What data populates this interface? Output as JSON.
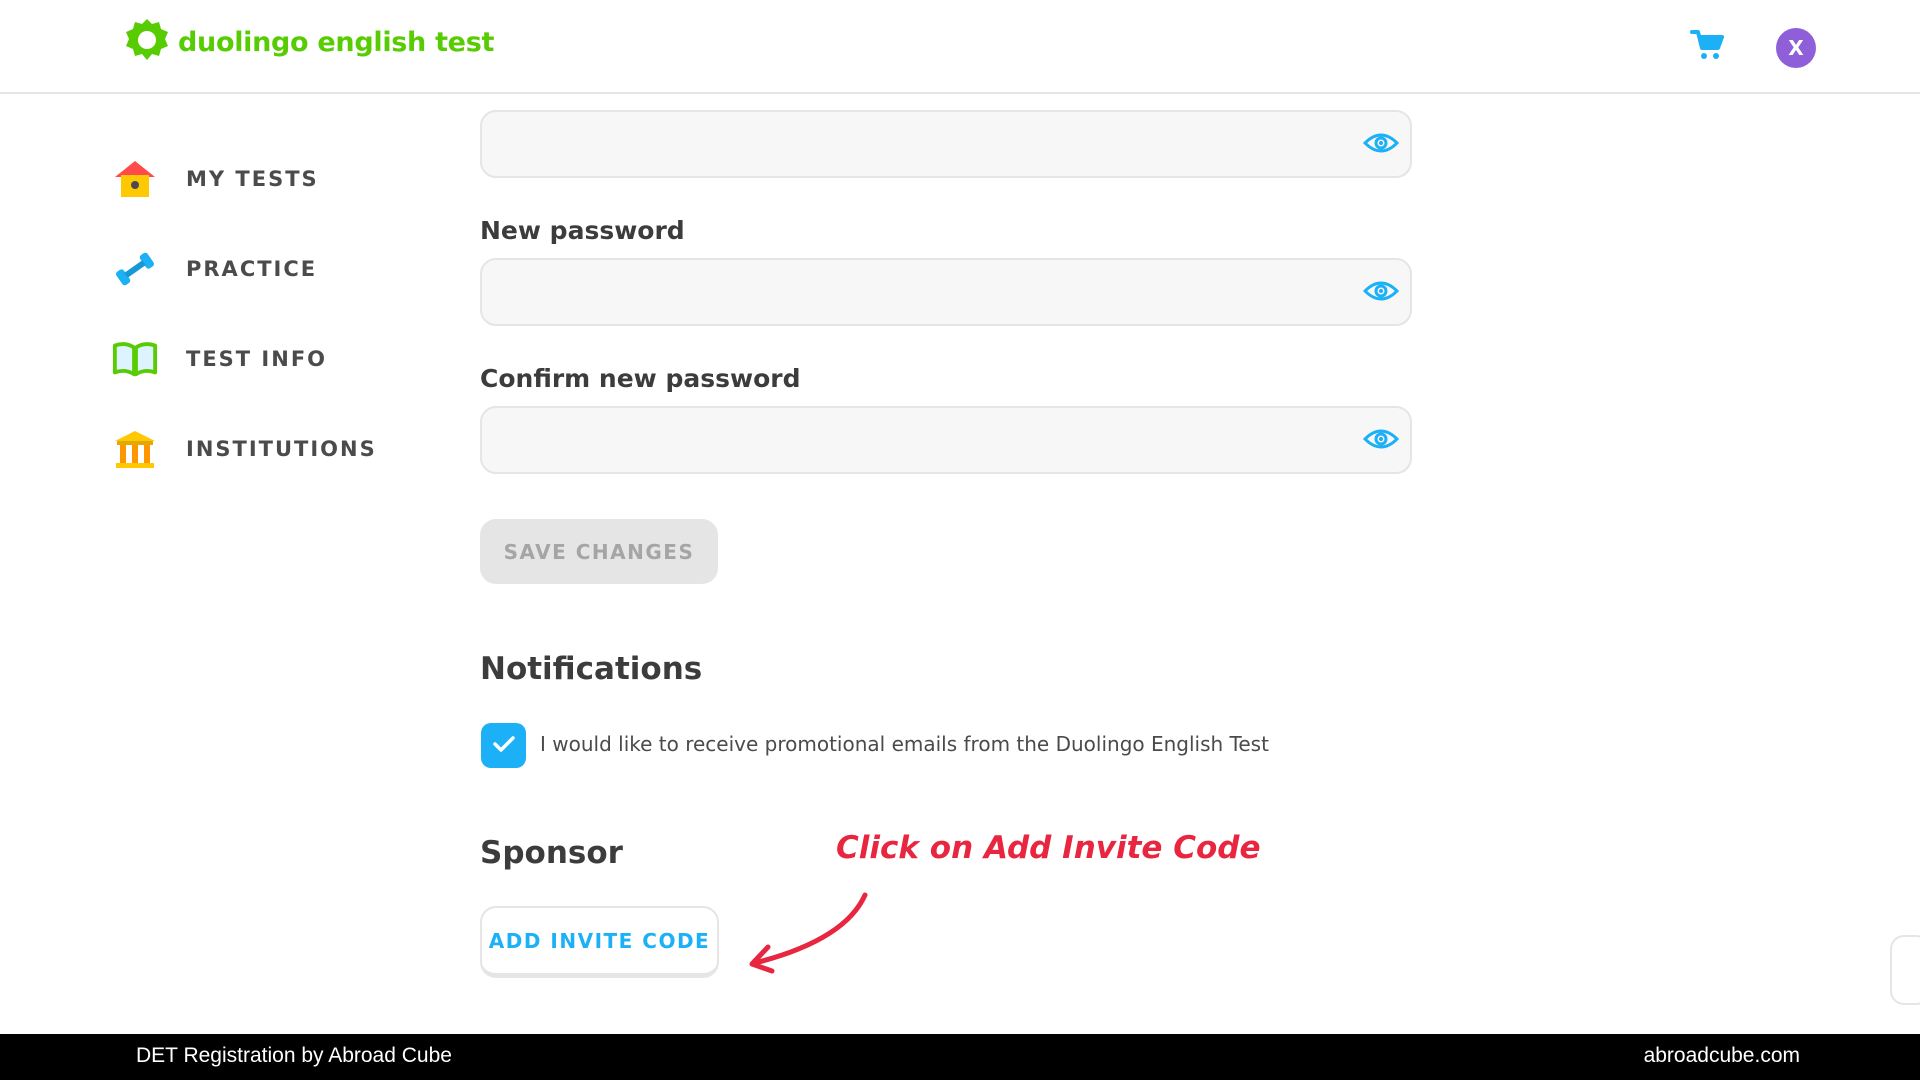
{
  "header": {
    "logo_text": "duolingo english test",
    "avatar_initial": "X",
    "brand_color": "#58cc02",
    "accent_color": "#1cb0f6"
  },
  "sidebar": {
    "items": [
      {
        "label": "MY TESTS",
        "icon": "house-icon"
      },
      {
        "label": "PRACTICE",
        "icon": "dumbbell-icon"
      },
      {
        "label": "TEST INFO",
        "icon": "book-icon"
      },
      {
        "label": "INSTITUTIONS",
        "icon": "institution-icon"
      }
    ]
  },
  "form": {
    "new_password_label": "New password",
    "confirm_password_label": "Confirm new password",
    "save_label": "SAVE CHANGES"
  },
  "notifications": {
    "title": "Notifications",
    "promo_label": "I would like to receive promotional emails from the Duolingo English Test",
    "promo_checked": true
  },
  "sponsor": {
    "title": "Sponsor",
    "invite_label": "ADD INVITE CODE"
  },
  "annotation": {
    "text": "Click on Add Invite Code",
    "color": "#e8263f"
  },
  "footer": {
    "left_text": "DET Registration by Abroad Cube",
    "right_text": "abroadcube.com"
  }
}
